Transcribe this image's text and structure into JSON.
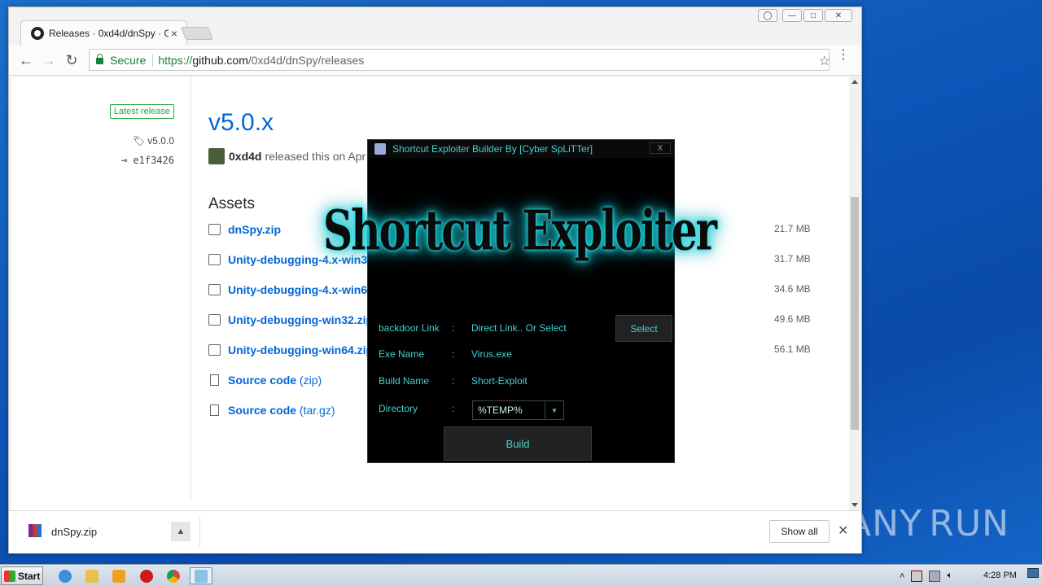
{
  "browser": {
    "tab_title": "Releases · 0xd4d/dnSpy · G",
    "tab_close": "×",
    "secure_label": "Secure",
    "url_proto": "https://",
    "url_host": "github.com",
    "url_path": "/0xd4d/dnSpy/releases"
  },
  "release": {
    "badge": "Latest release",
    "tag": "v5.0.0",
    "commit": "e1f3426",
    "title": "v5.0.x",
    "author": "0xd4d",
    "meta_text": "released this on Apr",
    "assets_heading": "Assets",
    "assets": [
      {
        "name": "dnSpy.zip",
        "size": "21.7 MB"
      },
      {
        "name": "Unity-debugging-4.x-win32",
        "size": "31.7 MB"
      },
      {
        "name": "Unity-debugging-4.x-win64",
        "size": "34.6 MB"
      },
      {
        "name": "Unity-debugging-win32.zip",
        "size": "49.6 MB"
      },
      {
        "name": "Unity-debugging-win64.zip",
        "size": "56.1 MB"
      }
    ],
    "source_zip_label": "Source code",
    "source_zip_ext": "(zip)",
    "source_tar_label": "Source code",
    "source_tar_ext": "(tar.gz)"
  },
  "downloads": {
    "file_name": "dnSpy.zip",
    "show_all": "Show all",
    "close": "✕"
  },
  "dialog": {
    "title": "Shortcut Exploiter Builder  By [Cyber SpLiTTer]",
    "close": "X",
    "banner": "Shortcut Exploiter",
    "fields": {
      "backdoor_label": "backdoor Link",
      "backdoor_value": "Direct Link.. Or Select",
      "exe_label": "Exe Name",
      "exe_value": "Virus.exe",
      "build_name_label": "Build Name",
      "build_name_value": "Short-Exploit",
      "directory_label": "Directory",
      "directory_value": "%TEMP%",
      "colon": ":"
    },
    "select_button": "Select",
    "build_button": "Build"
  },
  "taskbar": {
    "start": "Start",
    "clock": "4:28 PM"
  },
  "watermark": {
    "left": "ANY",
    "right": "RUN"
  }
}
